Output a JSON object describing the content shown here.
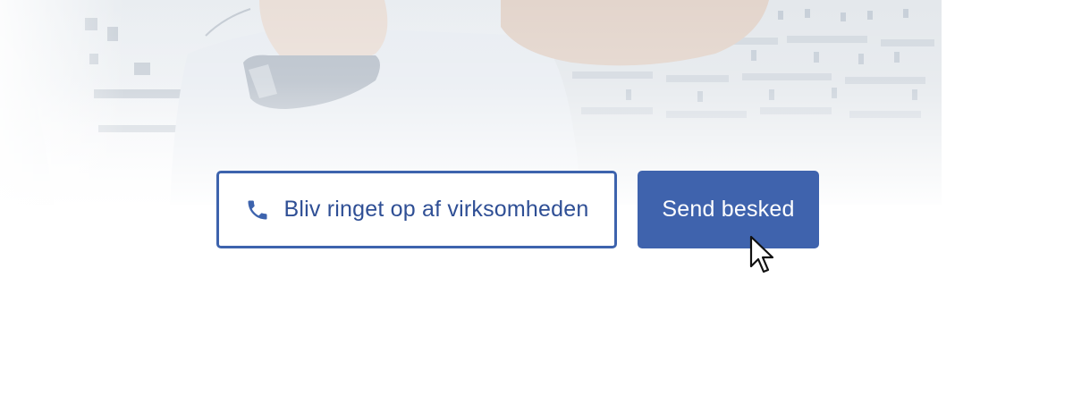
{
  "hero": {
    "image_name": "person-on-phone-photo"
  },
  "actions": {
    "callback_label": "Bliv ringet op af virksomheden",
    "callback_icon": "phone-icon",
    "send_label": "Send besked"
  },
  "colors": {
    "accent": "#3f63ad",
    "accent_text": "#2f4f95",
    "button_text_light": "#ffffff"
  },
  "cursor": {
    "icon": "mouse-pointer-icon"
  }
}
